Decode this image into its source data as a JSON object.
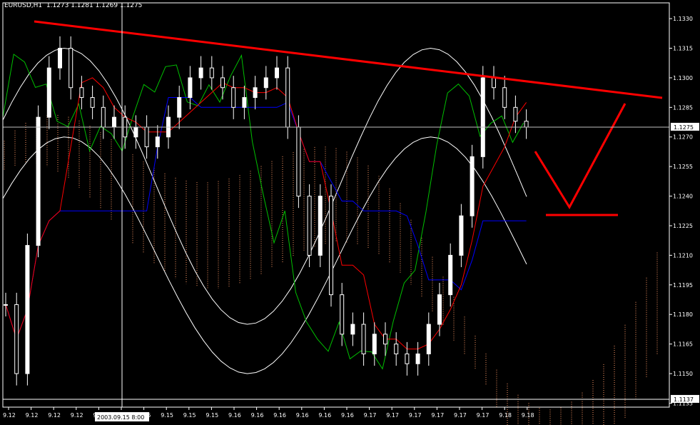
{
  "window_label": "EURUSD,H1",
  "ohlc_text": "1.1273 1.1281 1.1269 1.1275",
  "colors": {
    "background": "#000000",
    "axis": "#ffffff",
    "candle": "#ffffff",
    "trendline": "#ff0000",
    "tenkan": "#ff0000",
    "kijun": "#0000ff",
    "chikou": "#00c000",
    "bands": "#ffffff",
    "kumo": "#ff9966"
  },
  "chart_data": {
    "type": "candlestick",
    "title": "",
    "y_ticks": [
      "1.1330",
      "1.1315",
      "1.1300",
      "1.1285",
      "1.1270",
      "1.1255",
      "1.1240",
      "1.1225",
      "1.1210",
      "1.1195",
      "1.1180",
      "1.1165",
      "1.1150",
      "1.1135"
    ],
    "x_tick_labels": [
      "9.12",
      "9.12",
      "9.12",
      "9.12",
      "9.12",
      "9.15",
      "9.15",
      "9.15",
      "9.15",
      "9.15",
      "9.16",
      "9.16",
      "9.16",
      "9.16",
      "9.16",
      "9.16",
      "9.17",
      "9.17",
      "9.17",
      "9.17",
      "9.17",
      "9.17",
      "9.18",
      "9.18"
    ],
    "cursor_time_label": "2003.09.15 8:00",
    "current_price_label": "1.1275",
    "horizontal_line_label": "1.1137",
    "current_price": 1.1275,
    "horizontal_line_price": 1.1137,
    "ylim": [
      1.1133,
      1.1338
    ],
    "closes": [
      1.1185,
      1.115,
      1.1215,
      1.128,
      1.1305,
      1.1315,
      1.1295,
      1.129,
      1.1285,
      1.1275,
      1.128,
      1.127,
      1.1275,
      1.1265,
      1.127,
      1.128,
      1.129,
      1.13,
      1.1305,
      1.13,
      1.1295,
      1.1285,
      1.129,
      1.1295,
      1.13,
      1.1305,
      1.1275,
      1.124,
      1.121,
      1.124,
      1.119,
      1.117,
      1.1175,
      1.116,
      1.117,
      1.1165,
      1.116,
      1.1155,
      1.116,
      1.1175,
      1.119,
      1.121,
      1.123,
      1.126,
      1.13,
      1.1295,
      1.1285,
      1.1278,
      1.1275
    ]
  }
}
